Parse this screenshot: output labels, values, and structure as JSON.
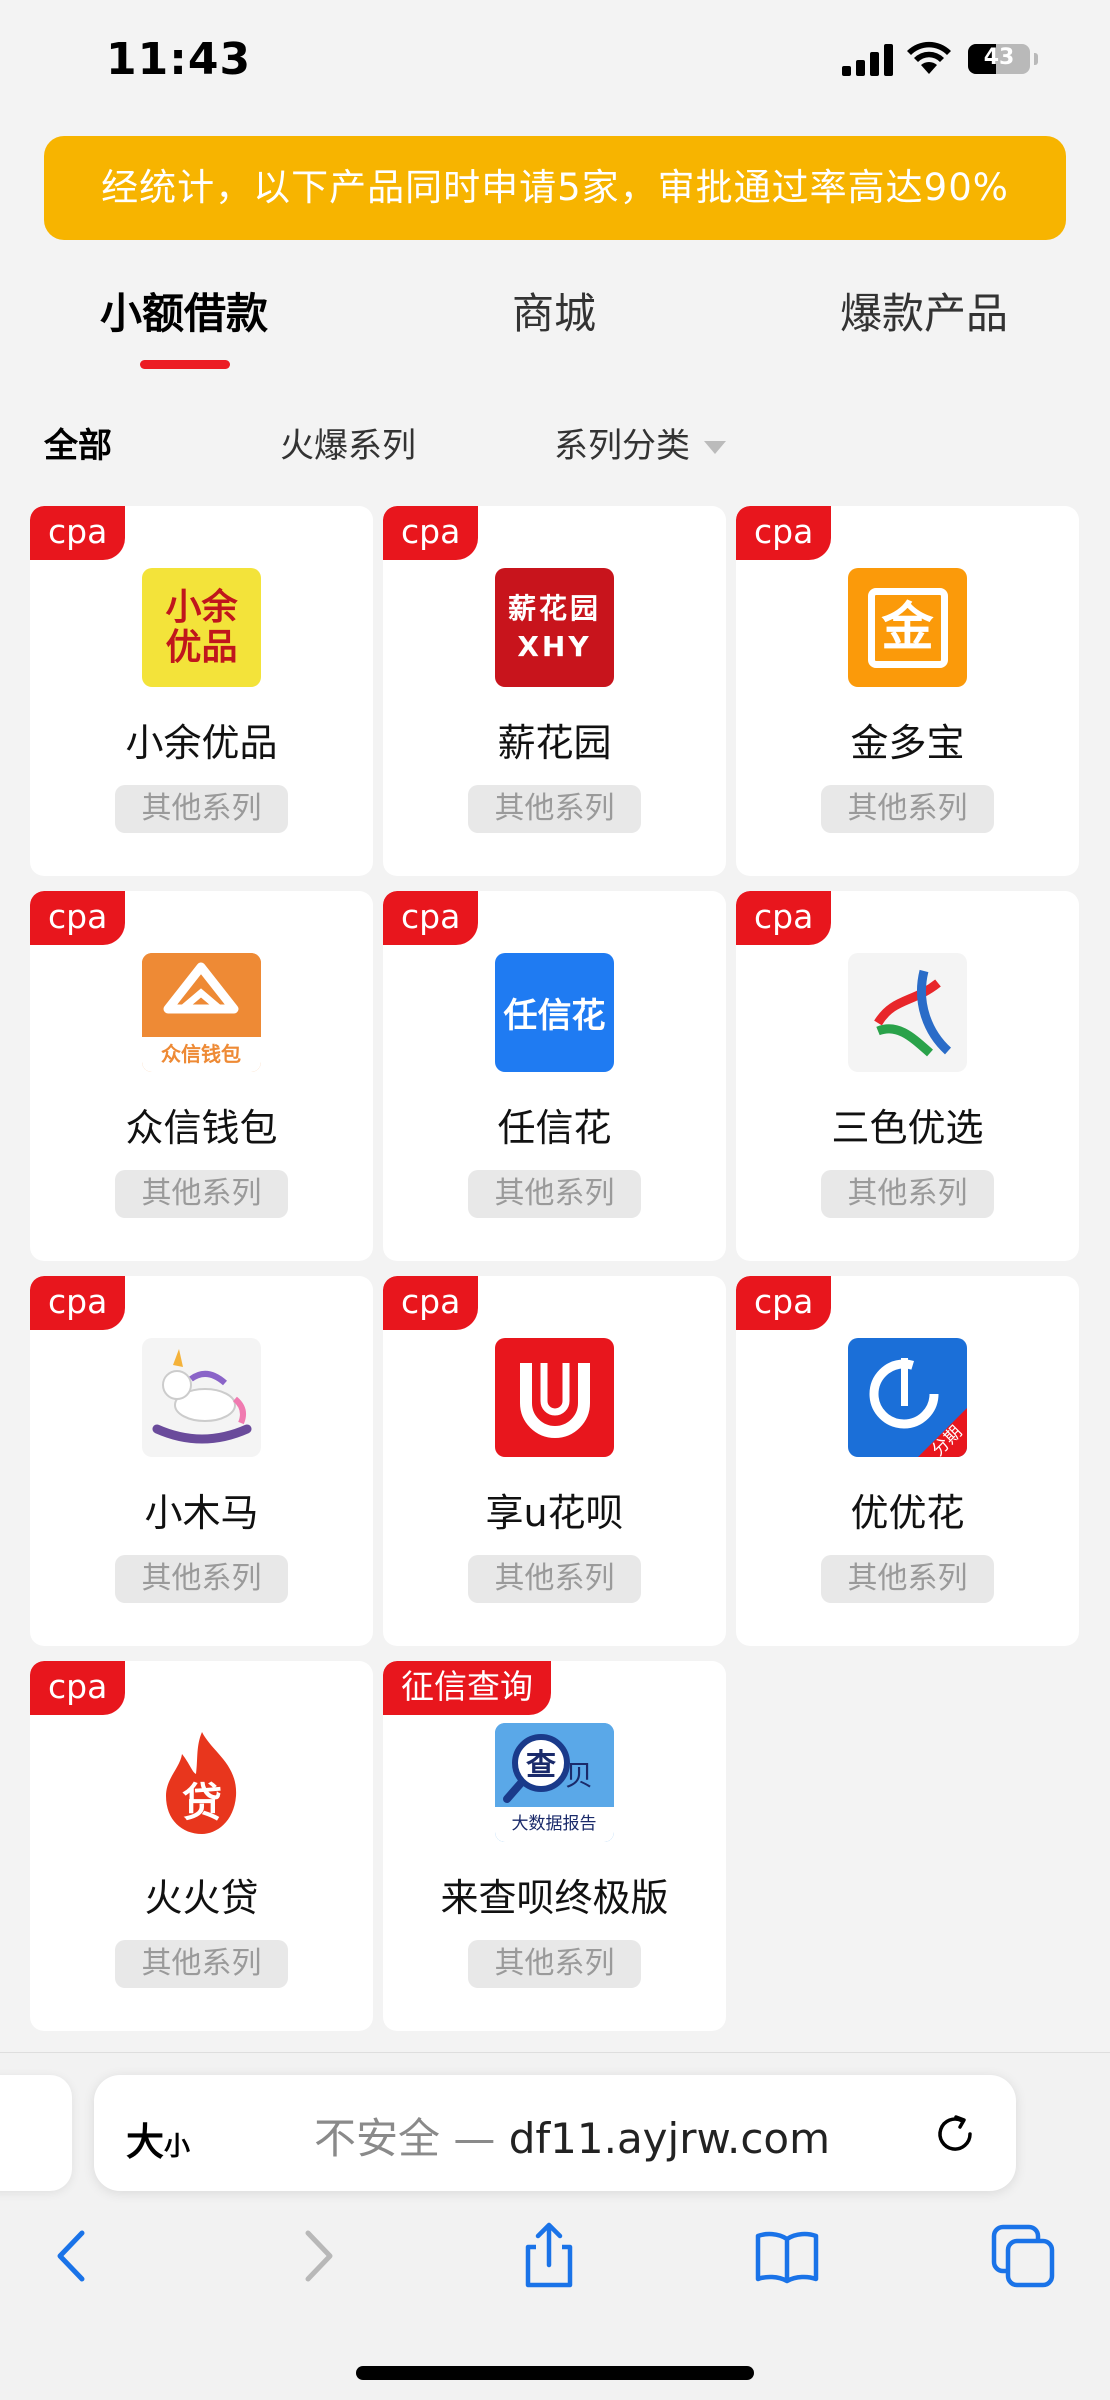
{
  "status_bar": {
    "time": "11:43",
    "battery": "43"
  },
  "banner": {
    "text": "经统计，以下产品同时申请5家，审批通过率高达90%"
  },
  "tabs": [
    {
      "label": "小额借款",
      "active": true
    },
    {
      "label": "商城",
      "active": false
    },
    {
      "label": "爆款产品",
      "active": false
    }
  ],
  "filters": [
    {
      "label": "全部",
      "active": true
    },
    {
      "label": "火爆系列",
      "active": false
    },
    {
      "label": "系列分类",
      "active": false,
      "dropdown": true
    }
  ],
  "products": [
    {
      "tag": "cpa",
      "name": "小余优品",
      "series": "其他系列",
      "logo": {
        "icon": "xiaoyu-logo",
        "text": "小余\n优品",
        "bg": "#f3e33a",
        "fg": "#c0161c"
      }
    },
    {
      "tag": "cpa",
      "name": "薪花园",
      "series": "其他系列",
      "logo": {
        "icon": "xinhuayuan-logo",
        "text": "薪花园\nXHY",
        "bg": "#c8141c",
        "fg": "#ffffff"
      }
    },
    {
      "tag": "cpa",
      "name": "金多宝",
      "series": "其他系列",
      "logo": {
        "icon": "jinduobao-logo",
        "text": "金",
        "bg": "#fb9a0a",
        "fg": "#ffffff"
      }
    },
    {
      "tag": "cpa",
      "name": "众信钱包",
      "series": "其他系列",
      "logo": {
        "icon": "zhongxin-logo",
        "text": "众信钱包",
        "bg": "#ee8a35",
        "fg": "#ffffff"
      }
    },
    {
      "tag": "cpa",
      "name": "任信花",
      "series": "其他系列",
      "logo": {
        "icon": "renxinhua-logo",
        "text": "任信花",
        "bg": "#1f7bf2",
        "fg": "#ffffff"
      }
    },
    {
      "tag": "cpa",
      "name": "三色优选",
      "series": "其他系列",
      "logo": {
        "icon": "sanse-logo",
        "text": "",
        "bg": "#f4f4f4",
        "fg": "#2a6cc8"
      }
    },
    {
      "tag": "cpa",
      "name": "小木马",
      "series": "其他系列",
      "logo": {
        "icon": "rocking-horse-logo",
        "text": "",
        "bg": "#f4f4f4",
        "fg": "#6a4b9b"
      }
    },
    {
      "tag": "cpa",
      "name": "享u花呗",
      "series": "其他系列",
      "logo": {
        "icon": "xiangu-logo",
        "text": "U",
        "bg": "#e8161d",
        "fg": "#ffffff"
      }
    },
    {
      "tag": "cpa",
      "name": "优优花",
      "series": "其他系列",
      "logo": {
        "icon": "youyouhua-logo",
        "text": "分期",
        "bg": "#1b6fd8",
        "fg": "#ffffff"
      }
    },
    {
      "tag": "cpa",
      "name": "火火贷",
      "series": "其他系列",
      "logo": {
        "icon": "flame-logo",
        "text": "贷",
        "bg": "#ffffff",
        "fg": "#e8361d"
      }
    },
    {
      "tag": "征信查询",
      "name": "来查呗终极版",
      "series": "其他系列",
      "logo": {
        "icon": "laichabei-logo",
        "text": "查 贝\n大数据报告",
        "bg": "#5aa8e8",
        "fg": "#1a2a6a"
      }
    }
  ],
  "browser": {
    "text_size_label": "大",
    "text_size_small": "小",
    "insecure_label": "不安全 — ",
    "domain": "df11.ayjrw.com"
  }
}
